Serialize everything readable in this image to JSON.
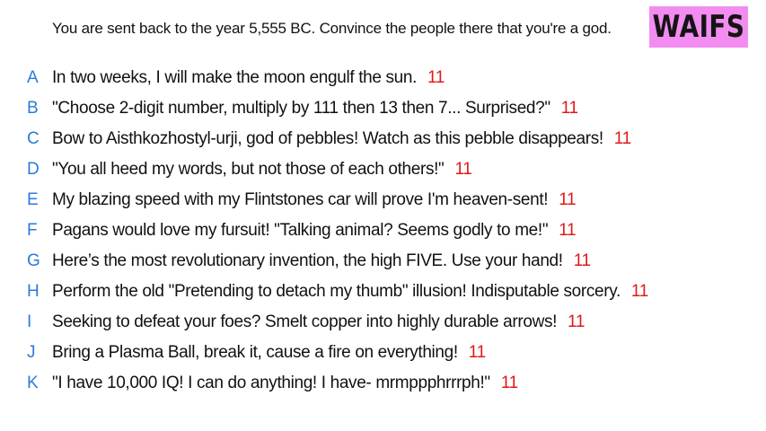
{
  "prompt": "You are sent back to the year 5,555 BC. Convince the people there that you're a god.",
  "logo": {
    "text": "WAIFS",
    "background": "#f28cf0"
  },
  "colors": {
    "letter": "#2b7bd8",
    "score": "#e01a1a",
    "text": "#111111"
  },
  "answers": [
    {
      "letter": "A",
      "text": "In two weeks, I will make the moon engulf the sun.",
      "score": "11"
    },
    {
      "letter": "B",
      "text": "\"Choose 2-digit number, multiply by 111 then 13 then 7... Surprised?\"",
      "score": "11"
    },
    {
      "letter": "C",
      "text": "Bow to Aisthkozhostyl-urji, god of pebbles! Watch as this pebble disappears!",
      "score": "11"
    },
    {
      "letter": "D",
      "text": "\"You all heed my words, but not those of each others!\"",
      "score": "11"
    },
    {
      "letter": "E",
      "text": "My blazing speed with my Flintstones car will prove I'm heaven-sent!",
      "score": "11"
    },
    {
      "letter": "F",
      "text": "Pagans would love my fursuit! \"Talking animal? Seems godly to me!\"",
      "score": "11"
    },
    {
      "letter": "G",
      "text": "Here’s the most revolutionary invention, the high FIVE. Use your hand!",
      "score": "11"
    },
    {
      "letter": "H",
      "text": "Perform the old \"Pretending to detach my thumb\" illusion! Indisputable sorcery.",
      "score": "11"
    },
    {
      "letter": "I",
      "text": "Seeking to defeat your foes? Smelt copper into highly durable arrows!",
      "score": "11"
    },
    {
      "letter": "J",
      "text": "Bring a Plasma Ball, break it, cause a fire on everything!",
      "score": "11"
    },
    {
      "letter": "K",
      "text": "\"I have 10,000 IQ! I can do anything! I have- mrmppphrrrph!\"",
      "score": "11"
    }
  ]
}
